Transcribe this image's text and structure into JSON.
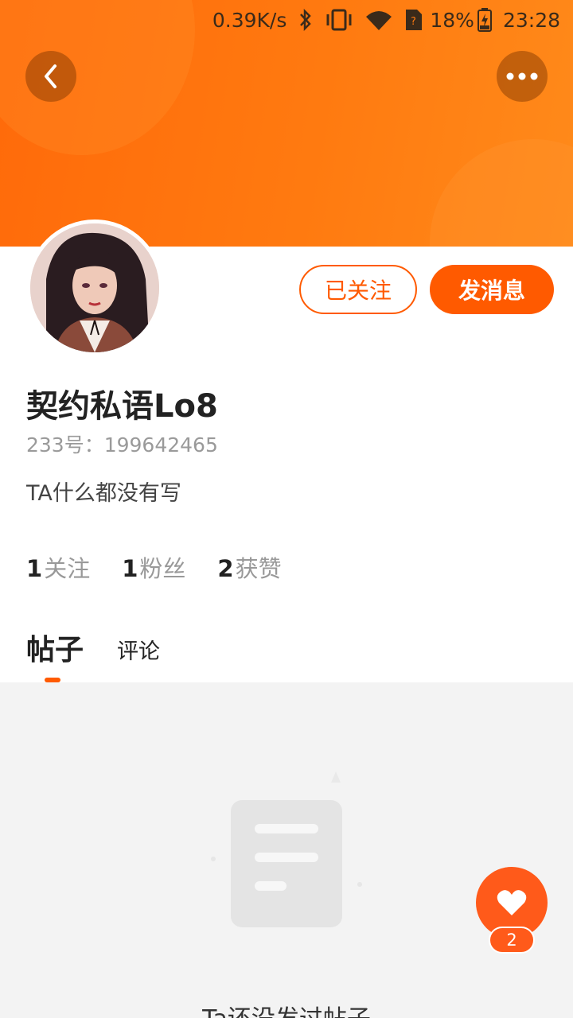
{
  "status_bar": {
    "net_speed": "0.39K/s",
    "battery": "18%",
    "time": "23:28"
  },
  "profile": {
    "username": "契约私语Lo8",
    "uid_text": "233号：199642465",
    "bio": "TA什么都没有写"
  },
  "actions": {
    "follow_label": "已关注",
    "message_label": "发消息"
  },
  "stats": [
    {
      "num": "1",
      "label": "关注"
    },
    {
      "num": "1",
      "label": "粉丝"
    },
    {
      "num": "2",
      "label": "获赞"
    }
  ],
  "tabs": {
    "posts": "帖子",
    "comments": "评论"
  },
  "empty_state": {
    "text": "Ta还没发过帖子"
  },
  "like": {
    "count": "2"
  },
  "colors": {
    "accent": "#ff5a00",
    "header_gradient": [
      "#ff6a0a",
      "#ff8a1a"
    ],
    "content_bg": "#f3f3f3"
  },
  "icons": [
    "chevron-left-icon",
    "more-dots-icon",
    "bluetooth-icon",
    "vibrate-icon",
    "wifi-icon",
    "sim-unknown-icon",
    "battery-charging-icon",
    "document-icon",
    "heart-icon"
  ]
}
